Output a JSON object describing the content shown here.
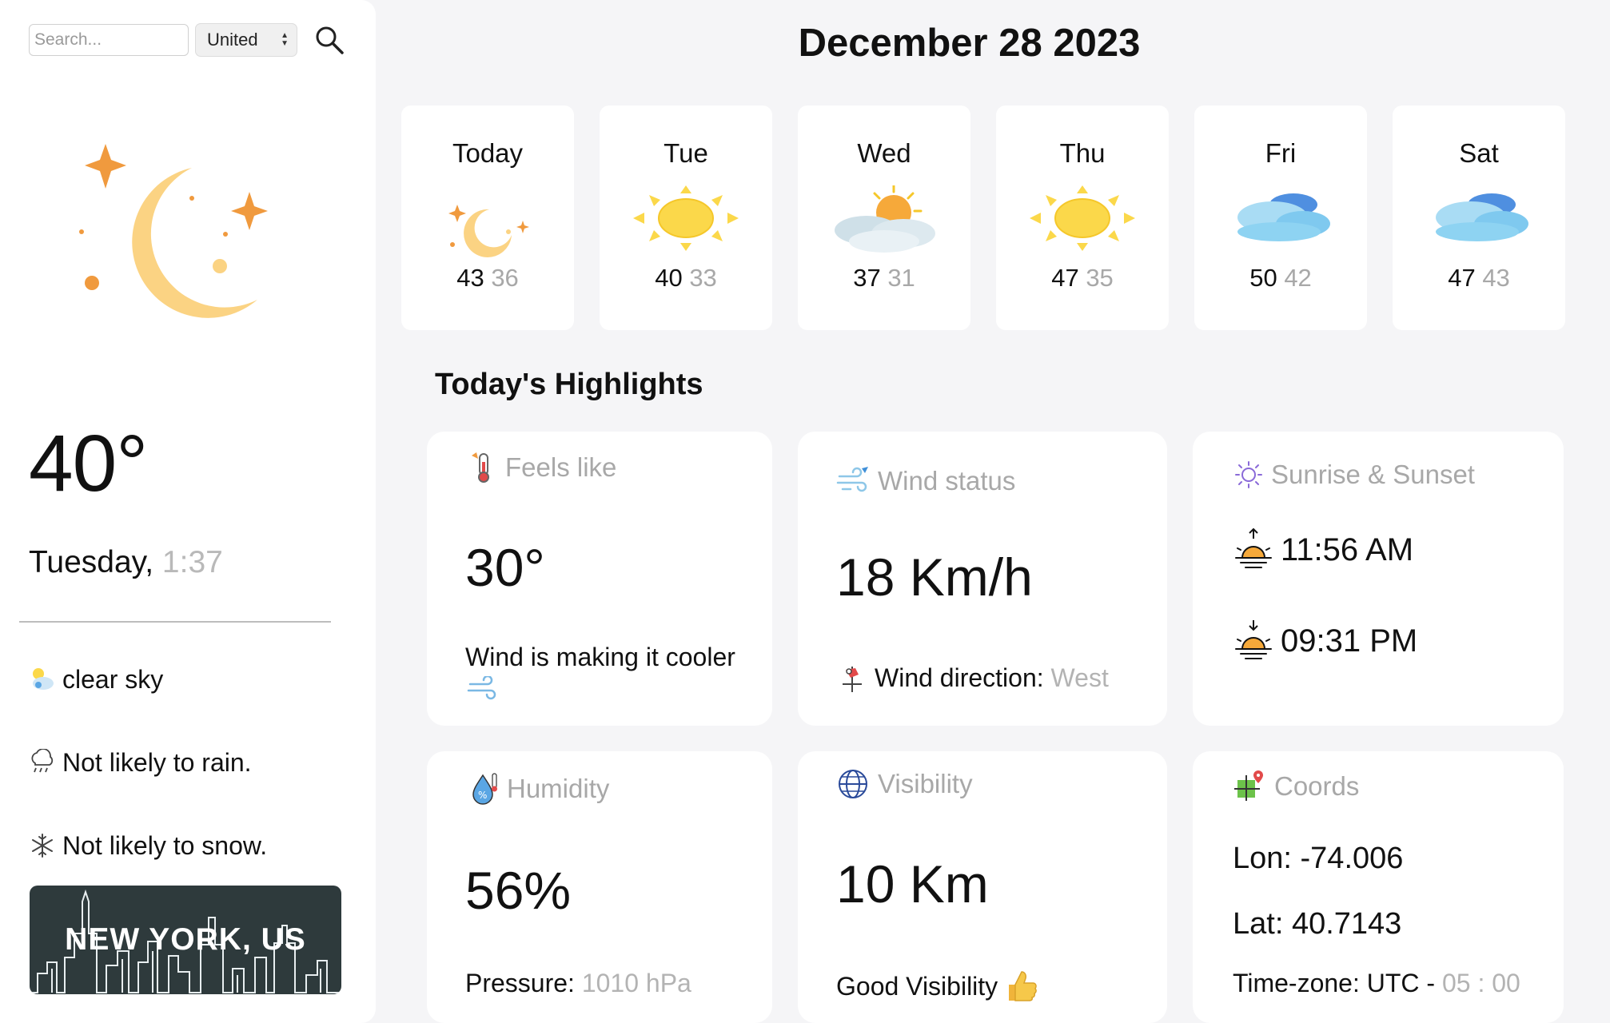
{
  "search": {
    "placeholder": "Search...",
    "country": "United"
  },
  "current": {
    "temperature": "40°",
    "day": "Tuesday,",
    "time": "1:37",
    "condition": "clear sky",
    "rain": "Not likely to rain.",
    "snow": "Not likely to snow.",
    "city": "NEW YORK, US"
  },
  "page_date": "December 28 2023",
  "forecast": [
    {
      "day": "Today",
      "max": "43",
      "min": "36",
      "icon": "moon-stars-icon"
    },
    {
      "day": "Tue",
      "max": "40",
      "min": "33",
      "icon": "sun-icon"
    },
    {
      "day": "Wed",
      "max": "37",
      "min": "31",
      "icon": "sun-behind-clouds-icon"
    },
    {
      "day": "Thu",
      "max": "47",
      "min": "35",
      "icon": "sun-icon"
    },
    {
      "day": "Fri",
      "max": "50",
      "min": "42",
      "icon": "clouds-icon"
    },
    {
      "day": "Sat",
      "max": "47",
      "min": "43",
      "icon": "clouds-icon"
    }
  ],
  "highlights": {
    "title": "Today's Highlights",
    "feels_like": {
      "label": "Feels like",
      "value": "30°",
      "note": "Wind is making it cooler"
    },
    "wind": {
      "label": "Wind status",
      "value": "18 Km/h",
      "direction_label": "Wind direction:",
      "direction_value": "West"
    },
    "sun": {
      "label": "Sunrise & Sunset",
      "sunrise": "11:56 AM",
      "sunset": "09:31 PM"
    },
    "humidity": {
      "label": "Humidity",
      "value": "56%",
      "pressure_label": "Pressure:",
      "pressure_value": "1010 hPa"
    },
    "visibility": {
      "label": "Visibility",
      "value": "10 Km",
      "note": "Good Visibility"
    },
    "coords": {
      "label": "Coords",
      "lon": "Lon: -74.006",
      "lat": "Lat: 40.7143",
      "tz_label": "Time-zone: UTC -",
      "tz_value": "05 : 00"
    }
  },
  "colors": {
    "accent_orange": "#f09a3e",
    "moon_yellow": "#fbd383",
    "sun_yellow": "#fbd84a",
    "cloud_blue": "#8ed3f2",
    "city_bg": "#2e3a3c"
  }
}
